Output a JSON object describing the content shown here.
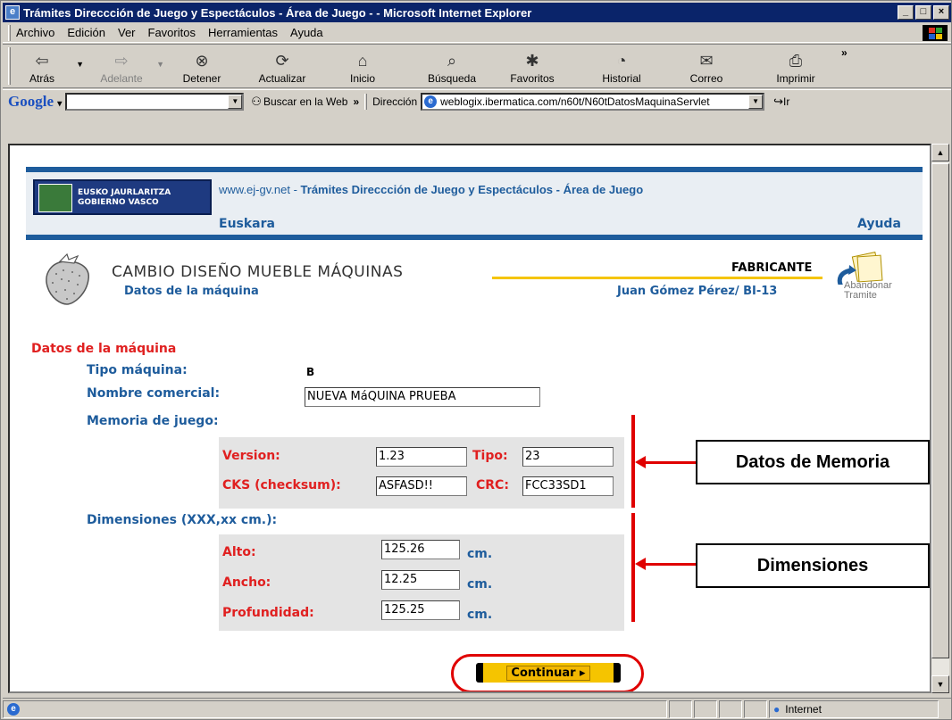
{
  "window": {
    "title": "Trámites Direccción de Juego y Espectáculos - Área de Juego - - Microsoft Internet Explorer"
  },
  "menu": [
    "Archivo",
    "Edición",
    "Ver",
    "Favoritos",
    "Herramientas",
    "Ayuda"
  ],
  "toolbar": {
    "back": "Atrás",
    "forward": "Adelante",
    "stop": "Detener",
    "refresh": "Actualizar",
    "home": "Inicio",
    "search": "Búsqueda",
    "favorites": "Favoritos",
    "history": "Historial",
    "mail": "Correo",
    "print": "Imprimir"
  },
  "google": {
    "logo": "Google",
    "search_label": "Buscar en la Web"
  },
  "address": {
    "label": "Dirección",
    "url": "weblogix.ibermatica.com/n60t/N60tDatosMaquinaServlet",
    "go": "Ir"
  },
  "header": {
    "logo_line1": "EUSKO JAURLARITZA",
    "logo_line2": "GOBIERNO VASCO",
    "site": "www.ej-gv.net",
    "sep": " - ",
    "site_title": "Trámites Direccción de Juego y Espectáculos - Área de Juego",
    "euskara": "Euskara",
    "ayuda": "Ayuda"
  },
  "page": {
    "title": "CAMBIO DISEÑO MUEBLE MÁQUINAS",
    "subtitle": "Datos de la máquina",
    "role": "FABRICANTE",
    "user": "Juan Gómez Pérez/ BI-13",
    "abandon_line1": "Abandonar",
    "abandon_line2": "Tramite"
  },
  "form": {
    "section": "Datos de la máquina",
    "tipo_label": "Tipo máquina:",
    "tipo_value": "B",
    "nombre_label": "Nombre comercial:",
    "nombre_value": "NUEVA MáQUINA PRUEBA",
    "memoria_label": "Memoria de juego:",
    "version_label": "Version:",
    "version_value": "1.23",
    "tipo2_label": "Tipo:",
    "tipo2_value": "23",
    "cks_label": "CKS (checksum):",
    "cks_value": "ASFASD!!",
    "crc_label": "CRC:",
    "crc_value": "FCC33SD1",
    "dim_label": "Dimensiones (XXX,xx cm.):",
    "alto_label": "Alto:",
    "alto_value": "125.26",
    "ancho_label": "Ancho:",
    "ancho_value": "12.25",
    "prof_label": "Profundidad:",
    "prof_value": "125.25",
    "unit": "cm.",
    "continue": "Continuar ▸"
  },
  "annotations": {
    "memoria": "Datos de Memoria",
    "dimensiones": "Dimensiones"
  },
  "status": {
    "zone": "Internet"
  }
}
